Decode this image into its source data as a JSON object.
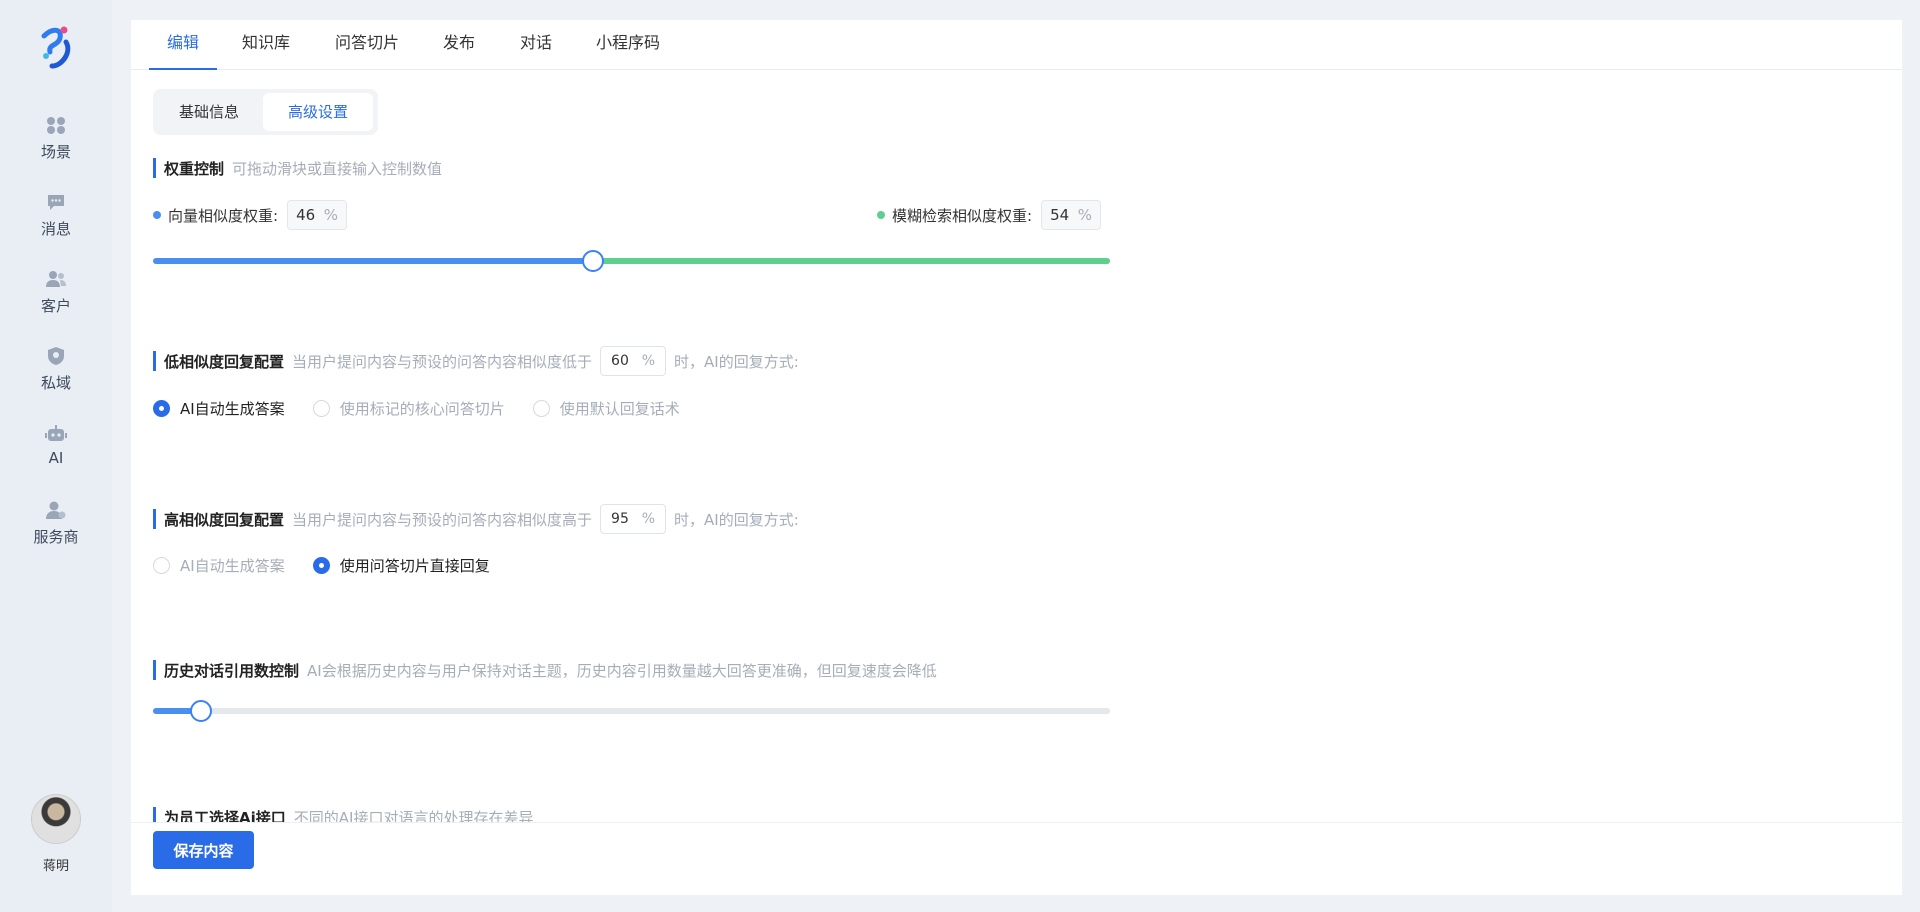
{
  "sidebar": {
    "items": [
      {
        "label": "场景",
        "icon": "grid-icon"
      },
      {
        "label": "消息",
        "icon": "chat-icon"
      },
      {
        "label": "客户",
        "icon": "user-group-icon"
      },
      {
        "label": "私域",
        "icon": "shield-icon"
      },
      {
        "label": "AI",
        "icon": "robot-icon"
      },
      {
        "label": "服务商",
        "icon": "service-user-icon"
      }
    ],
    "user_name": "蒋明"
  },
  "tabs": [
    "编辑",
    "知识库",
    "问答切片",
    "发布",
    "对话",
    "小程序码"
  ],
  "active_tab": 0,
  "segment": {
    "basic": "基础信息",
    "advanced": "高级设置"
  },
  "weight": {
    "title": "权重控制",
    "desc": "可拖动滑块或直接输入控制数值",
    "vector_label": "向量相似度权重:",
    "vector_value": "46",
    "fuzzy_label": "模糊检索相似度权重:",
    "fuzzy_value": "54",
    "unit": "%",
    "slider_value_pct": 46
  },
  "low_sim": {
    "title": "低相似度回复配置",
    "desc_before": "当用户提问内容与预设的问答内容相似度低于",
    "threshold": "60",
    "unit": "%",
    "desc_after": "时，AI的回复方式:",
    "options": [
      "AI自动生成答案",
      "使用标记的核心问答切片",
      "使用默认回复话术"
    ],
    "selected": 0
  },
  "high_sim": {
    "title": "高相似度回复配置",
    "desc_before": "当用户提问内容与预设的问答内容相似度高于",
    "threshold": "95",
    "unit": "%",
    "desc_after": "时，AI的回复方式:",
    "options": [
      "AI自动生成答案",
      "使用问答切片直接回复"
    ],
    "selected": 1
  },
  "history": {
    "title": "历史对话引用数控制",
    "desc": "AI会根据历史内容与用户保持对话主题，历史内容引用数量越大回答更准确，但回复速度会降低",
    "slider_value_pct": 5
  },
  "ai_api": {
    "title": "为员工选择Ai接口",
    "desc": "不同的AI接口对语言的处理存在差异"
  },
  "save_label": "保存内容",
  "colors": {
    "accent": "#2a6ce8",
    "vector": "#4a8ff0",
    "fuzzy": "#5dcf8e"
  }
}
